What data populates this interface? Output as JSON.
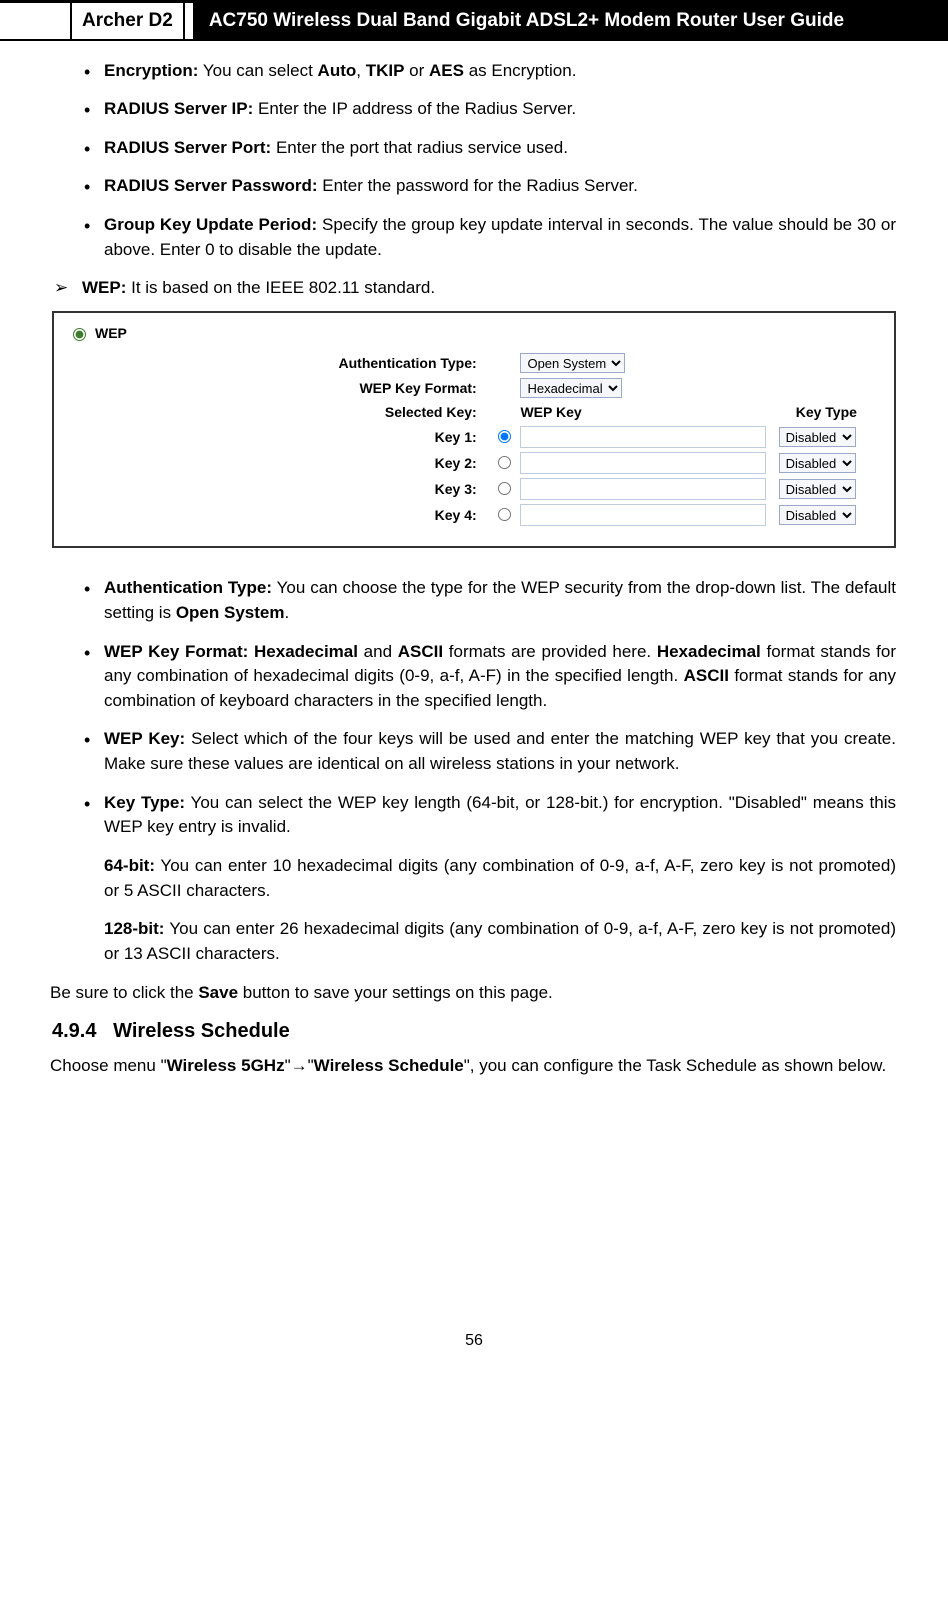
{
  "header": {
    "model": "Archer D2",
    "title": "AC750 Wireless Dual Band Gigabit ADSL2+ Modem Router User Guide"
  },
  "top_bullets": [
    {
      "label": "Encryption:",
      "text": " You can select ",
      "t2": "Auto",
      "t3": ", ",
      "t4": "TKIP",
      "t5": " or ",
      "t6": "AES",
      "t7": " as Encryption."
    },
    {
      "label": "RADIUS Server IP:",
      "text": " Enter the IP address of the Radius Server."
    },
    {
      "label": "RADIUS Server Port:",
      "text": " Enter the port that radius service used."
    },
    {
      "label": "RADIUS Server Password:",
      "text": " Enter the password for the Radius Server."
    },
    {
      "label": "Group Key Update Period:",
      "text": " Specify the group key update interval in seconds. The value should be 30 or above. Enter 0 to disable the update."
    }
  ],
  "wep_line": {
    "label": "WEP:",
    "text": " It is based on the IEEE 802.11 standard."
  },
  "shot": {
    "radio_label": "WEP",
    "auth_label": "Authentication Type:",
    "auth_value": "Open System",
    "fmt_label": "WEP Key Format:",
    "fmt_value": "Hexadecimal",
    "sel_label": "Selected Key:",
    "wepkey_head": "WEP Key",
    "keytype_head": "Key Type",
    "keys": [
      {
        "label": "Key 1:",
        "checked": true,
        "type": "Disabled"
      },
      {
        "label": "Key 2:",
        "checked": false,
        "type": "Disabled"
      },
      {
        "label": "Key 3:",
        "checked": false,
        "type": "Disabled"
      },
      {
        "label": "Key 4:",
        "checked": false,
        "type": "Disabled"
      }
    ]
  },
  "mid_bullets": {
    "auth": {
      "label": "Authentication Type:",
      "t1": " You can choose the type for the WEP security from the drop-down list. The default setting is ",
      "t2": "Open System",
      "t3": "."
    },
    "fmt": {
      "label": "WEP Key Format:",
      "t1": " ",
      "t2": "Hexadecimal",
      "t3": " and ",
      "t4": "ASCII",
      "t5": " formats are provided here. ",
      "t6": "Hexadecimal",
      "t7": " format stands for any combination of hexadecimal digits (0-9, a-f, A-F) in the specified length. ",
      "t8": "ASCII",
      "t9": " format stands for any combination of keyboard characters in the specified length."
    },
    "wkey": {
      "label": "WEP Key:",
      "t1": " Select which of the four keys will be used and enter the matching WEP key that you create. Make sure these values are identical on all wireless stations in your network."
    },
    "ktype": {
      "label": "Key Type:",
      "t1": " You can select the WEP key length (64-bit, or 128-bit.) for encryption. \"Disabled\" means this WEP key entry is invalid."
    },
    "k64": {
      "label": "64-bit:",
      "t1": "  You can enter 10 hexadecimal digits (any combination of 0-9, a-f, A-F, zero key is not promoted) or 5 ASCII characters."
    },
    "k128": {
      "label": "128-bit:",
      "t1": " You can enter 26 hexadecimal digits (any combination of 0-9, a-f, A-F, zero key is not promoted) or 13 ASCII characters."
    }
  },
  "save_line": {
    "t1": "Be sure to click the ",
    "t2": "Save",
    "t3": " button to save your settings on this page."
  },
  "section": {
    "num": "4.9.4",
    "title": "Wireless Schedule"
  },
  "sched_line": {
    "t1": "Choose menu \"",
    "t2": "Wireless 5GHz",
    "t3": "\"",
    "arrow": "→",
    "t4": "\"",
    "t5": "Wireless Schedule",
    "t6": "\", you can configure the Task Schedule as shown below."
  },
  "page": "56"
}
